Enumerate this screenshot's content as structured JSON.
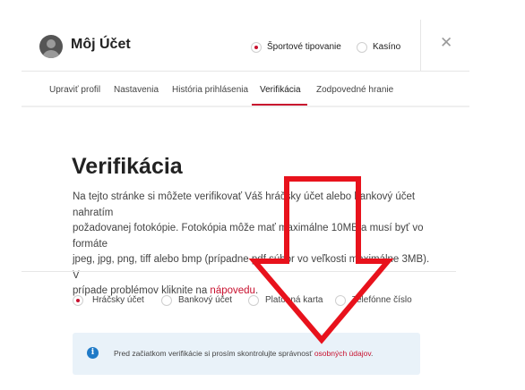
{
  "header": {
    "title": "Môj Účet",
    "avatar_icon": "user-avatar-icon",
    "mode_options": [
      {
        "label": "Športové tipovanie",
        "selected": true
      },
      {
        "label": "Kasíno",
        "selected": false
      }
    ],
    "close_icon": "close-icon"
  },
  "tabs": [
    {
      "label": "Upraviť profil",
      "active": false
    },
    {
      "label": "Nastavenia",
      "active": false
    },
    {
      "label": "História prihlásenia",
      "active": false
    },
    {
      "label": "Verifikácia",
      "active": true
    },
    {
      "label": "Zodpovedné hranie",
      "active": false
    }
  ],
  "main": {
    "heading": "Verifikácia",
    "paragraph_line1": "Na tejto stránke si môžete verifikovať Váš hráčsky účet alebo bankový účet nahratím",
    "paragraph_line2": "požadovanej fotokópie. Fotokópia môže mať maximálne 10MB a musí byť vo formáte",
    "paragraph_line3": "jpeg, jpg, png, tiff alebo bmp (prípadne pdf súbor vo veľkosti maximálne 3MB). V",
    "paragraph_line4_prefix": "prípade problémov kliknite na ",
    "help_link": "nápovedu",
    "paragraph_line4_suffix": ".",
    "verification_types": [
      {
        "label": "Hráčsky účet",
        "selected": true
      },
      {
        "label": "Bankový účet",
        "selected": false
      },
      {
        "label": "Platobná karta",
        "selected": false
      },
      {
        "label": "Telefónne číslo",
        "selected": false
      }
    ],
    "info": {
      "icon": "info-icon",
      "icon_glyph": "i",
      "text": "Pred začiatkom verifikácie si prosím skontrolujte správnosť ",
      "link": "osobných údajov",
      "suffix": "."
    }
  },
  "colors": {
    "accent": "#c8102e",
    "info_background": "#e9f2f9",
    "info_icon": "#1f7ac7",
    "annotation_arrow": "#e8121c"
  },
  "annotation": {
    "icon": "down-arrow-icon"
  }
}
